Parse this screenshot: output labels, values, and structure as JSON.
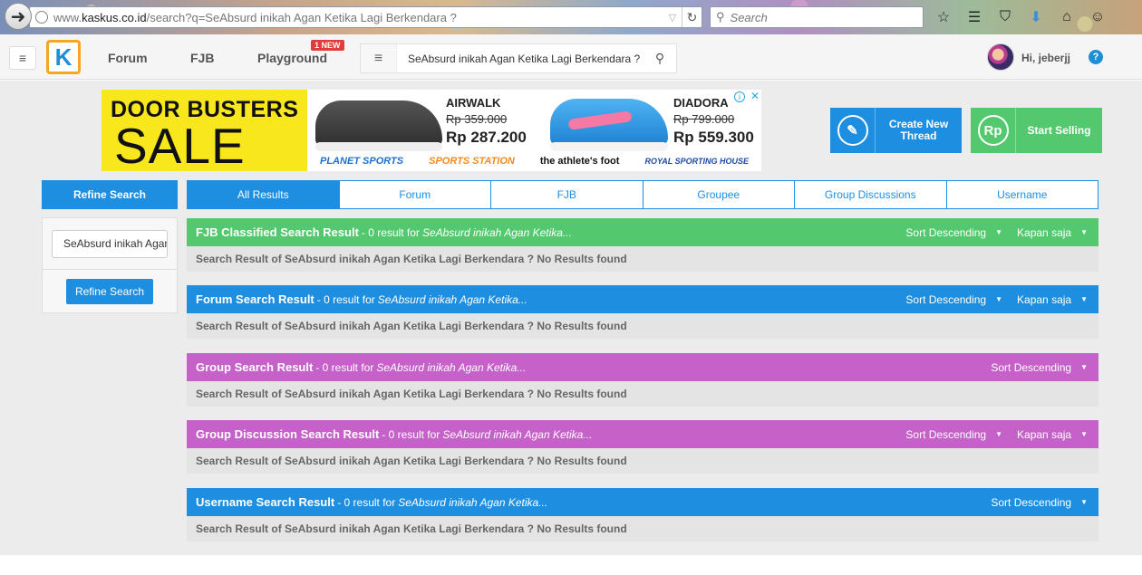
{
  "browser": {
    "url_prefix": "www.",
    "url_domain": "kaskus.co.id",
    "url_path": "/search?q=SeAbsurd inikah Agan Ketika Lagi Berkendara ?",
    "search_placeholder": "Search"
  },
  "nav": {
    "forum": "Forum",
    "fjb": "FJB",
    "playground": "Playground",
    "new_badge": "1 NEW",
    "search_value": "SeAbsurd inikah Agan Ketika Lagi Berkendara ?",
    "greeting": "Hi, jeberjj",
    "help": "?"
  },
  "banner": {
    "line1": "DOOR BUSTERS",
    "line2": "SALE",
    "brand1": "AIRWALK",
    "brand1_old": "Rp 359.000",
    "brand1_new": "Rp 287.200",
    "brand2": "DIADORA",
    "brand2_old": "Rp 799.000",
    "brand2_new": "Rp 559.300",
    "stores": [
      "PLANET SPORTS",
      "SPORTS STATION",
      "the athlete's foot",
      "ROYAL SPORTING HOUSE"
    ]
  },
  "cta": {
    "create_thread": "Create New Thread",
    "start_selling": "Start Selling",
    "rp_icon": "Rp"
  },
  "refine": {
    "header": "Refine Search",
    "input_value": "SeAbsurd inikah Agan Ketika Lagi Berkendara ?",
    "button": "Refine Search"
  },
  "tabs": [
    "All Results",
    "Forum",
    "FJB",
    "Groupee",
    "Group Discussions",
    "Username"
  ],
  "sections": [
    {
      "title": "FJB Classified Search Result",
      "meta": "- 0 result for",
      "query": "SeAbsurd inikah Agan Ketika...",
      "sort": "Sort Descending",
      "time": "Kapan saja",
      "body": "Search Result of SeAbsurd inikah Agan Ketika Lagi Berkendara ? No Results found",
      "color": "#54c86e"
    },
    {
      "title": "Forum Search Result",
      "meta": "- 0 result for",
      "query": "SeAbsurd inikah Agan Ketika...",
      "sort": "Sort Descending",
      "time": "Kapan saja",
      "body": "Search Result of SeAbsurd inikah Agan Ketika Lagi Berkendara ? No Results found",
      "color": "#1e8fe0"
    },
    {
      "title": "Group Search Result",
      "meta": "- 0 result for",
      "query": "SeAbsurd inikah Agan Ketika...",
      "sort": "Sort Descending",
      "body": "Search Result of SeAbsurd inikah Agan Ketika Lagi Berkendara ? No Results found",
      "color": "#c561c9"
    },
    {
      "title": "Group Discussion Search Result",
      "meta": "- 0 result for",
      "query": "SeAbsurd inikah Agan Ketika...",
      "sort": "Sort Descending",
      "time": "Kapan saja",
      "body": "Search Result of SeAbsurd inikah Agan Ketika Lagi Berkendara ? No Results found",
      "color": "#c561c9"
    },
    {
      "title": "Username Search Result",
      "meta": "- 0 result for",
      "query": "SeAbsurd inikah Agan Ketika...",
      "sort": "Sort Descending",
      "body": "Search Result of SeAbsurd inikah Agan Ketika Lagi Berkendara ? No Results found",
      "color": "#1e8fe0"
    }
  ]
}
